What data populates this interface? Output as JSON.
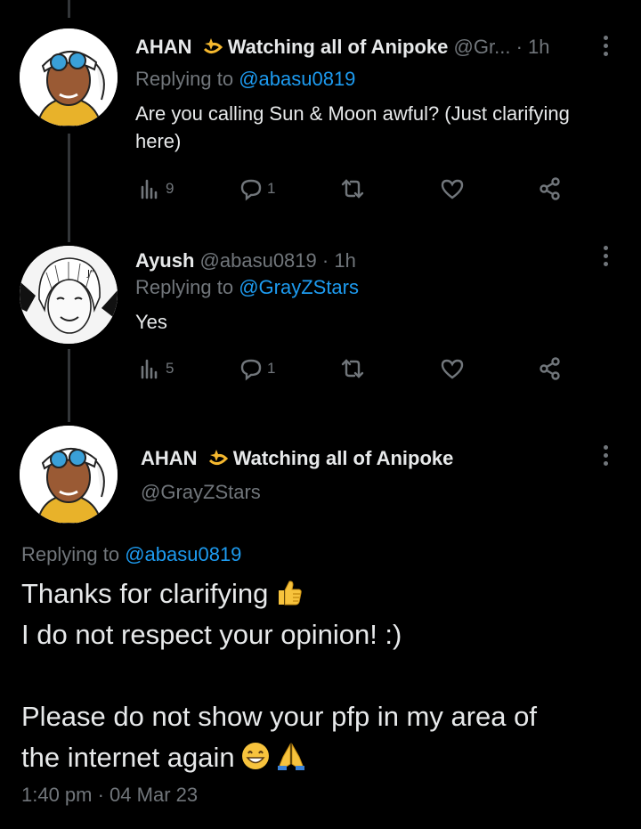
{
  "tweets": [
    {
      "name": "AHAN",
      "name_suffix": "Watching all of Anipoke",
      "handle": "@Gr...",
      "time": "1h",
      "replying_prefix": "Replying to",
      "replying_to": "@abasu0819",
      "text_lines": [
        "Are you calling Sun & Moon awful? (Just clarifying",
        "here)"
      ],
      "views": "9",
      "replies": "1"
    },
    {
      "name": "Ayush",
      "handle": "@abasu0819",
      "time": "1h",
      "replying_prefix": "Replying to",
      "replying_to": "@GrayZStars",
      "text_lines": [
        "Yes"
      ],
      "views": "5",
      "replies": "1"
    }
  ],
  "main_tweet": {
    "name": "AHAN",
    "name_suffix": "Watching all of Anipoke",
    "handle": "@GrayZStars",
    "replying_prefix": "Replying to",
    "replying_to": "@abasu0819",
    "line1": "Thanks for clarifying",
    "line2": "I do not respect your opinion! :)",
    "line3": "Please do not show your pfp in my area of",
    "line4": "the internet again",
    "timestamp": "1:40 pm · 04 Mar 23"
  },
  "colors": {
    "background": "#000000",
    "text": "#e7e9ea",
    "muted": "#71767b",
    "link": "#1d9bf0"
  },
  "icons": [
    "sparkle-emoji",
    "views-icon",
    "reply-icon",
    "retweet-icon",
    "like-icon",
    "share-icon",
    "more-icon",
    "thumbs-up-emoji",
    "grin-emoji",
    "pray-emoji"
  ]
}
